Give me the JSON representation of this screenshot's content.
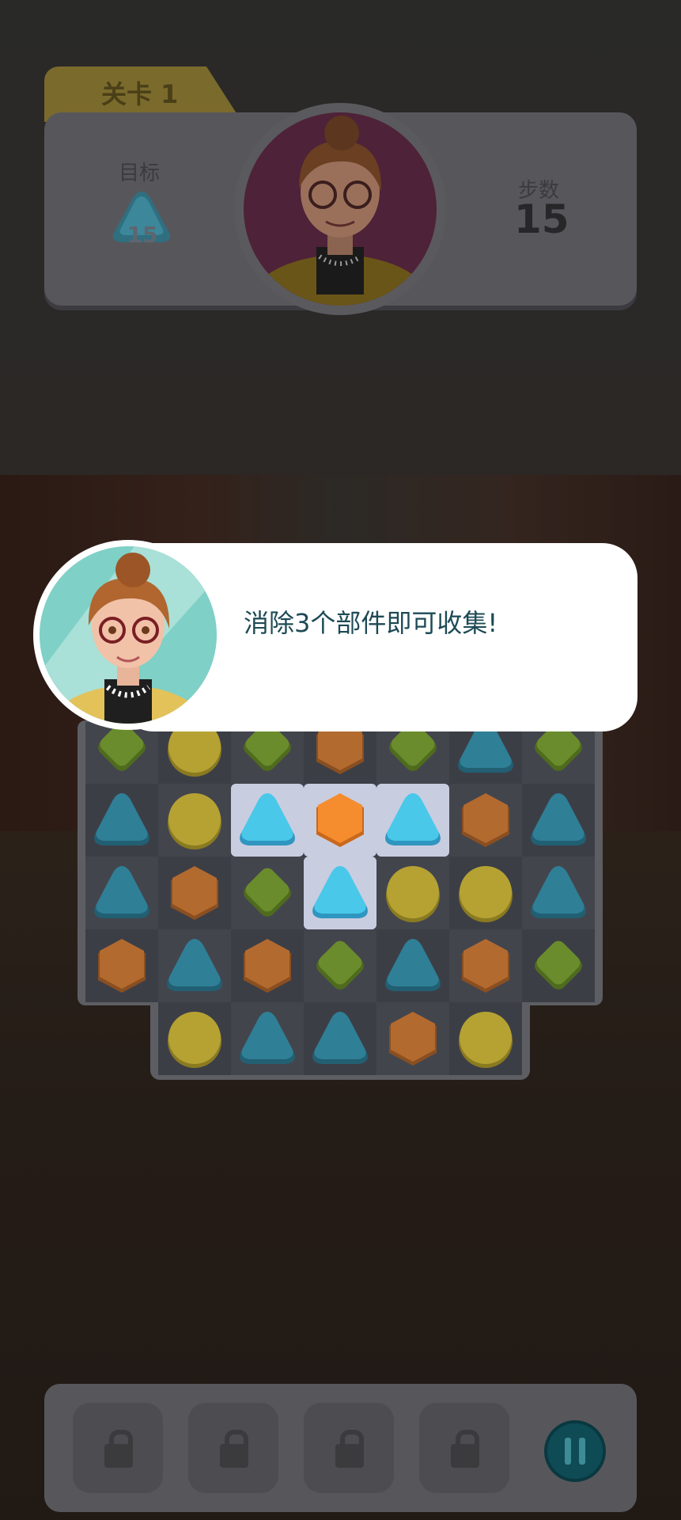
{
  "level": {
    "label": "关卡 1"
  },
  "target": {
    "label": "目标",
    "count": "15"
  },
  "steps": {
    "label": "步数",
    "value": "15"
  },
  "dialog": {
    "text": "消除3个部件即可收集!"
  },
  "board": {
    "rows": [
      [
        "green",
        "yellow",
        "green",
        "orange",
        "green",
        "blue",
        "green"
      ],
      [
        "blue",
        "yellow",
        "blue",
        "orange",
        "blue",
        "orange",
        "blue"
      ],
      [
        "blue",
        "orange",
        "green",
        "blue",
        "yellow",
        "yellow",
        "blue"
      ],
      [
        "orange",
        "blue",
        "orange",
        "green",
        "blue",
        "orange",
        "green"
      ],
      [
        "",
        "yellow",
        "blue",
        "blue",
        "orange",
        "yellow",
        ""
      ]
    ],
    "highlighted": [
      [
        1,
        2
      ],
      [
        1,
        3
      ],
      [
        1,
        4
      ],
      [
        2,
        3
      ]
    ]
  },
  "toolbar": {
    "slots": [
      "lock-icon",
      "lock-icon",
      "lock-icon",
      "lock-icon"
    ],
    "pause": "pause-icon"
  },
  "colors": {
    "green": "#6a8c2c",
    "yellow": "#b5a233",
    "blue": "#2f7f96",
    "orange": "#b36a2f",
    "blue_bright": "#49c8ea",
    "orange_bright": "#f58d2e"
  }
}
